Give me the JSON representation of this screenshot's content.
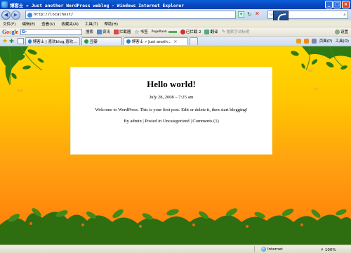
{
  "window": {
    "title": "博客士 » Just another WordPress weblog - Windows Internet Explorer",
    "minimize_icon": "minimize-icon",
    "maximize_icon": "maximize-icon",
    "close_icon": "close-icon"
  },
  "address_bar": {
    "url": "http://localhost/",
    "search_placeholder": "Google"
  },
  "menu": {
    "items": [
      "文件(F)",
      "编辑(E)",
      "查看(V)",
      "收藏夹(A)",
      "工具(T)",
      "帮助(H)"
    ]
  },
  "google_toolbar": {
    "logo": "Google",
    "search_value": "G-",
    "items": [
      "搜索",
      "资讯",
      "拦截器",
      "书签",
      "PageRank",
      "已拦截 2",
      "翻译",
      "搜索字词标明"
    ],
    "settings_label": "设置"
  },
  "tabs": {
    "items": [
      {
        "label": "博客士 | 喜欢blog,喜欢…",
        "active": false
      },
      {
        "label": "豆瓣",
        "active": false
      },
      {
        "label": "博客士 » Just anoth…",
        "active": true
      }
    ],
    "commands": [
      "页面(P)",
      "工具(O)"
    ]
  },
  "post": {
    "title": "Hello world!",
    "date": "July 28, 2008 – 7:25 am",
    "body": "Welcome to WordPress. This is your first post. Edit or delete it, then start blogging!",
    "author_prefix": "By",
    "author": "admin",
    "posted_in_prefix": "| Posted in",
    "category": "Uncategorized",
    "comments": "Comments (1)"
  },
  "status_bar": {
    "zone": "Internet",
    "zoom": "100%"
  }
}
